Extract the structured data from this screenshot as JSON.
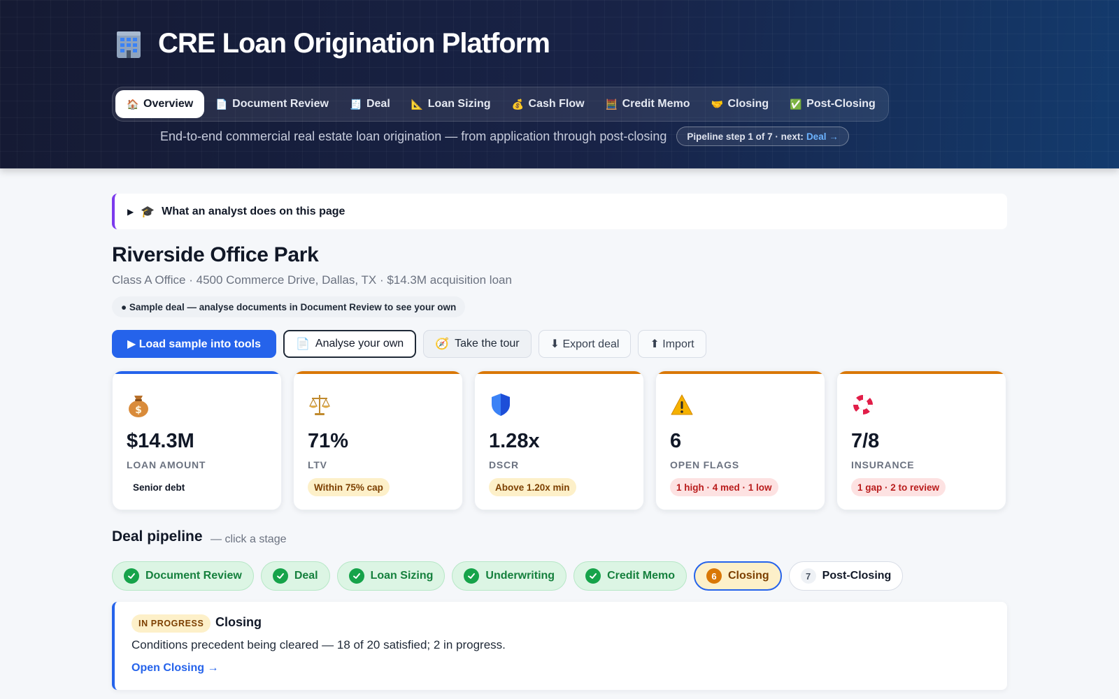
{
  "app": {
    "title": "CRE Loan Origination Platform",
    "subtitle": "End-to-end commercial real estate loan origination — from application through post-closing",
    "pipeline_step": "Pipeline step 1 of 7 · next:",
    "pipeline_next": "Deal →"
  },
  "tabs": [
    {
      "label": "Overview",
      "icon": "house-icon",
      "glyph": "🏠",
      "active": true
    },
    {
      "label": "Document Review",
      "icon": "document-icon",
      "glyph": "📄"
    },
    {
      "label": "Deal",
      "icon": "receipt-icon",
      "glyph": "🧾"
    },
    {
      "label": "Loan Sizing",
      "icon": "ruler-icon",
      "glyph": "📐"
    },
    {
      "label": "Cash Flow",
      "icon": "money-bag-icon",
      "glyph": "💰"
    },
    {
      "label": "Credit Memo",
      "icon": "abacus-icon",
      "glyph": "🧮"
    },
    {
      "label": "Closing",
      "icon": "handshake-icon",
      "glyph": "🤝"
    },
    {
      "label": "Post-Closing",
      "icon": "check-box-icon",
      "glyph": "✅"
    }
  ],
  "callout": {
    "label": "What an analyst does on this page",
    "icon": "graduation-cap-icon",
    "glyph": "🎓"
  },
  "deal": {
    "name": "Riverside Office Park",
    "description": "Class A Office · 4500 Commerce Drive, Dallas, TX · $14.3M acquisition loan",
    "sample_note": "● Sample deal — analyse documents in Document Review to see your own"
  },
  "actions": {
    "load_sample": "▶ Load sample into tools",
    "analyse_own": "Analyse your own",
    "take_tour": "Take the tour",
    "export_deal": "⬇ Export deal",
    "import": "⬆ Import"
  },
  "kpis": [
    {
      "value": "$14.3M",
      "label": "LOAN AMOUNT",
      "badge": "Senior debt",
      "icon": "money-bag-icon",
      "accent": "#2563eb",
      "badge_style": "plain"
    },
    {
      "value": "71%",
      "label": "LTV",
      "badge": "Within 75% cap",
      "icon": "scales-icon",
      "accent": "#d97706",
      "badge_style": "amber"
    },
    {
      "value": "1.28x",
      "label": "DSCR",
      "badge": "Above 1.20x min",
      "icon": "shield-icon",
      "accent": "#d97706",
      "badge_style": "amber"
    },
    {
      "value": "6",
      "label": "OPEN FLAGS",
      "badge": "1 high · 4 med · 1 low",
      "icon": "warning-icon",
      "accent": "#d97706",
      "badge_style": "red"
    },
    {
      "value": "7/8",
      "label": "INSURANCE",
      "badge": "1 gap · 2 to review",
      "icon": "life-ring-icon",
      "accent": "#d97706",
      "badge_style": "red"
    }
  ],
  "pipeline": {
    "title": "Deal pipeline",
    "hint": "— click a stage",
    "stages": [
      {
        "label": "Document Review",
        "status": "done"
      },
      {
        "label": "Deal",
        "status": "done"
      },
      {
        "label": "Loan Sizing",
        "status": "done"
      },
      {
        "label": "Underwriting",
        "status": "done"
      },
      {
        "label": "Credit Memo",
        "status": "done"
      },
      {
        "label": "Closing",
        "status": "current",
        "number": "6"
      },
      {
        "label": "Post-Closing",
        "status": "todo",
        "number": "7"
      }
    ]
  },
  "stage_detail": {
    "status": "IN PROGRESS",
    "title": "Closing",
    "text": "Conditions precedent being cleared — 18 of 20 satisfied; 2 in progress.",
    "link": "Open Closing →"
  },
  "colors": {
    "primary": "#2563eb",
    "amber": "#d97706",
    "success": "#16a34a",
    "callout_accent": "#7c3aed"
  }
}
